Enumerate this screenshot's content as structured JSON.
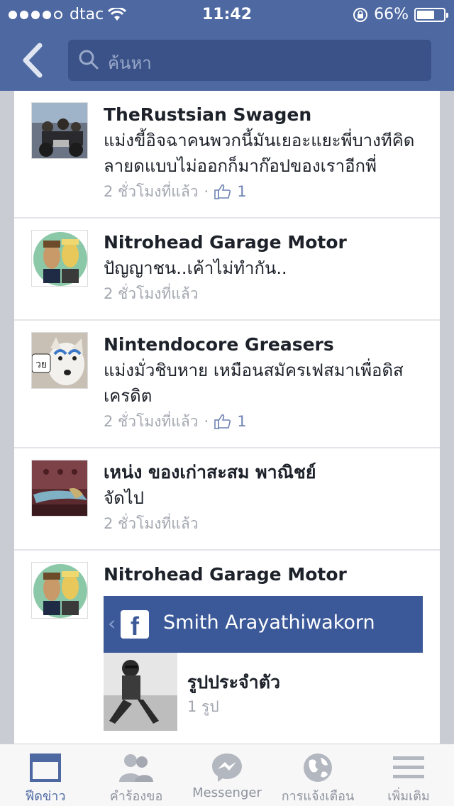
{
  "status": {
    "carrier": "dtac",
    "time": "11:42",
    "battery": "66%",
    "battery_level": 0.66
  },
  "search": {
    "placeholder": "ค้นหา"
  },
  "feed": [
    {
      "name": "TheRustsian Swagen",
      "text": "แม่งขี้อิจฉาคนพวกนี้มันเยอะแยะพี่บางทีคิดลายดแบบไม่ออกก็มาก๊อปของเราอีกพี่",
      "time": "2 ชั่วโมงที่แล้ว",
      "likes": "1"
    },
    {
      "name": "Nitrohead Garage Motor",
      "text": "ปัญญาชน..เค้าไม่ทำกัน..",
      "time": "2 ชั่วโมงที่แล้ว"
    },
    {
      "name": "Nintendocore Greasers",
      "text": "แม่งมั่วชิบหาย เหมือนสมัครเฟสมาเพื่อดิสเครดิต",
      "time": "2 ชั่วโมงที่แล้ว",
      "likes": "1",
      "thumb_text": "วย"
    },
    {
      "name": "เหน่ง ของเก่าสะสม พาณิชย์",
      "text": "จัดไป",
      "time": "2 ชั่วโมงที่แล้ว"
    },
    {
      "name": "Nitrohead Garage Motor",
      "share": {
        "page_name": "Smith Arayathiwakorn",
        "album_title": "รูปประจำตัว",
        "album_count": "1 รูป"
      }
    }
  ],
  "tabs": [
    {
      "label": "ฟีดข่าว",
      "icon": "news-feed-icon",
      "active": true
    },
    {
      "label": "คำร้องขอ",
      "icon": "friend-requests-icon"
    },
    {
      "label": "Messenger",
      "icon": "messenger-icon"
    },
    {
      "label": "การแจ้งเตือน",
      "icon": "globe-icon"
    },
    {
      "label": "เพิ่มเติม",
      "icon": "menu-icon"
    }
  ],
  "colors": {
    "brand": "#4e69a2",
    "search_bg": "#3a5288",
    "share_header": "#3b5998"
  }
}
